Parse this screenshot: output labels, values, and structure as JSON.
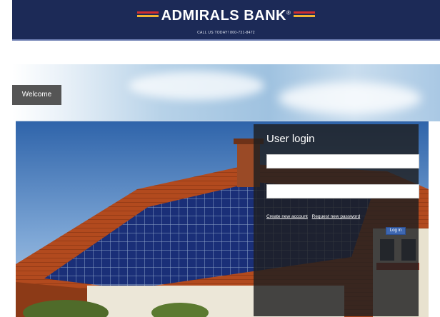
{
  "header": {
    "brand": "ADMIRALS BANK",
    "trademark": "®",
    "phone": "CALL US TODAY! 800-731-8472"
  },
  "nav": {
    "welcome_label": "Welcome"
  },
  "login": {
    "title": "User login",
    "username_value": "",
    "password_value": "",
    "create_account_label": "Create new account",
    "request_password_label": "Request new password",
    "login_button_label": "Log in"
  },
  "colors": {
    "header_bg": "#1c2a57",
    "accent_red": "#d32f2f",
    "accent_yellow": "#f2b632",
    "button_blue": "#3e67b1",
    "welcome_bg": "#555555"
  }
}
